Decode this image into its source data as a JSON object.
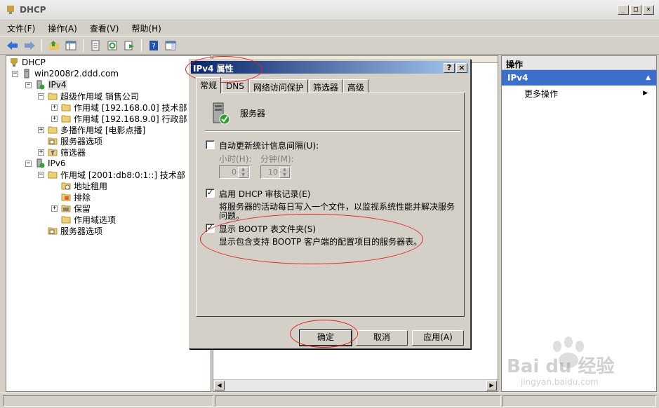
{
  "window": {
    "title": "DHCP",
    "controls": [
      "_",
      "□",
      "×"
    ]
  },
  "menu": {
    "items": [
      "文件(F)",
      "操作(A)",
      "查看(V)",
      "帮助(H)"
    ]
  },
  "toolbar": {
    "icons": [
      "back-arrow-icon",
      "forward-arrow-icon",
      "up-folder-icon",
      "show-hide-tree-icon",
      "properties-icon",
      "refresh-icon",
      "export-list-icon",
      "help-icon",
      "view-icon"
    ]
  },
  "tree": {
    "root": "DHCP",
    "server": "win2008r2.ddd.com",
    "ipv4": "IPv4",
    "superscope": "超级作用域 销售公司",
    "scope1": "作用域 [192.168.0.0] 技术部",
    "scope2": "作用域 [192.168.9.0] 行政部",
    "multicast": "多播作用域 [电影点播]",
    "server_options": "服务器选项",
    "filters": "筛选器",
    "ipv6": "IPv6",
    "scope6": "作用域 [2001:db8:0:1::] 技术部",
    "leases": "地址租用",
    "exclusions": "排除",
    "reservations": "保留",
    "scope_options": "作用域选项",
    "server_options6": "服务器选项"
  },
  "actions": {
    "header": "操作",
    "selected": "IPv4",
    "more": "更多操作"
  },
  "dialog": {
    "title": "IPv4 属性",
    "help_btn": "?",
    "close_btn": "×",
    "tabs": [
      "常规",
      "DNS",
      "网络访问保护",
      "筛选器",
      "高级"
    ],
    "server_label": "服务器",
    "auto_update": {
      "label": "自动更新统计信息间隔(U):",
      "checked": false,
      "hours_label": "小时(H):",
      "minutes_label": "分钟(M):",
      "hours_value": "0",
      "minutes_value": "10"
    },
    "audit": {
      "label": "启用 DHCP 审核记录(E)",
      "checked": true,
      "desc_line1": "将服务器的活动每日写入一个文件，以监视系统性能并解决服务",
      "desc_line2": "问题。"
    },
    "bootp": {
      "label": "显示 BOOTP 表文件夹(S)",
      "checked": true,
      "desc": "显示包含支持 BOOTP 客户端的配置项目的服务器表。"
    },
    "buttons": {
      "ok": "确定",
      "cancel": "取消",
      "apply": "应用(A)"
    }
  },
  "watermark": {
    "logo": "Bai du 经验",
    "url": "jingyan.baidu.com"
  },
  "colors": {
    "selection_blue": "#3c6ecb",
    "annotation_red": "#e02020",
    "title_gradient_start": "#0a246a"
  }
}
